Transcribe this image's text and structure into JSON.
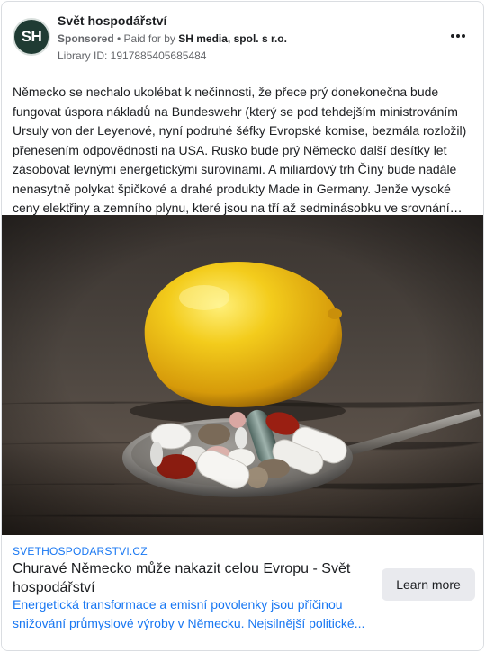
{
  "ad": {
    "page_name": "Svět hospodářství",
    "avatar_text": "SH",
    "sponsored_label": "Sponsored",
    "separator": " • ",
    "paid_for_prefix": "Paid for by ",
    "funder": "SH media, spol. s r.o.",
    "library_id": "Library ID: 1917885405685484",
    "more_icon": "three-dots-icon",
    "body": "Německo se nechalo ukolébat k nečinnosti, že přece prý donekonečna bude fungovat úspora nákladů na Bundeswehr (který se pod tehdejším ministrováním Ursuly von der Leyenové, nyní podruhé šéfky Evropské komise, bezmála rozložil) přenesením odpovědnosti na USA. Rusko bude prý Německo další desítky let zásobovat levnými energetickými surovinami. A miliardový trh Číny bude nadále nenasytně polykat špičkové a drahé produkty Made in Germany. Jenže vysoké ceny elektřiny a zemního plynu, které jsou na tří až sedminásobku ve srovnání s...",
    "image_description": "lemon-and-pills-on-spoon",
    "link": {
      "domain": "SVETHOSPODARSTVI.CZ",
      "title": "Churavé Německo může nakazit celou Evropu - Svět hospodářství",
      "description": "Energetická transformace a emisní povolenky jsou příčinou snižování průmyslové výroby v Německu. Nejsilnější politické...",
      "cta_label": "Learn more"
    }
  },
  "colors": {
    "link_blue": "#1877f2",
    "meta_gray": "#65676b",
    "avatar_bg": "#1f3b33",
    "button_bg": "#e9eaee"
  }
}
